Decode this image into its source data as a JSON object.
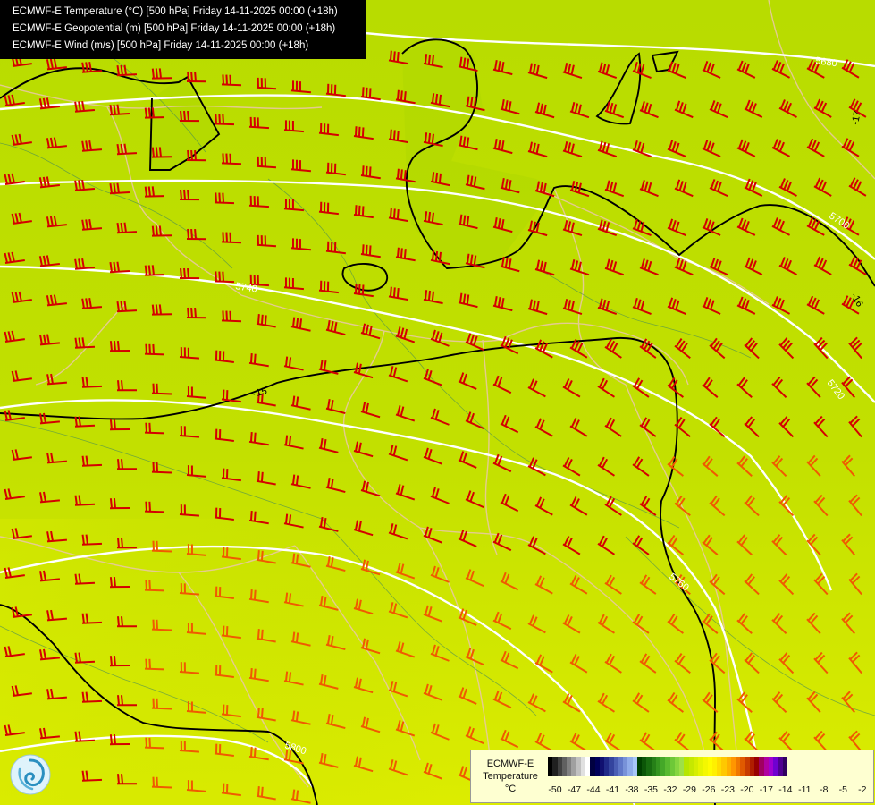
{
  "header": {
    "lines": [
      "ECMWF-E Temperature (°C) [500 hPa] Friday 14-11-2025 00:00 (+18h)",
      "ECMWF-E Geopotential (m) [500 hPa] Friday 14-11-2025 00:00 (+18h)",
      "ECMWF-E Wind (m/s) [500 hPa] Friday 14-11-2025 00:00 (+18h)"
    ]
  },
  "map": {
    "geopotential_labels": [
      "5680",
      "5700",
      "5720",
      "5740",
      "5760",
      "5800"
    ],
    "isotherm_labels": [
      "-15",
      "-16",
      "-17"
    ],
    "colors": {
      "background": "#c6e000",
      "geopotential_line": "#ffffff",
      "isotherm_line": "#000000",
      "wind_barb": "#d40000",
      "wind_barb_south": "#f05a00",
      "borders": "#e8c9a0",
      "rivers": "#2d7a6a"
    }
  },
  "legend": {
    "title_line1": "ECMWF-E",
    "title_line2": "Temperature",
    "unit": "°C",
    "ticks": [
      "-50",
      "-47",
      "-44",
      "-41",
      "-38",
      "-35",
      "-32",
      "-29",
      "-26",
      "-23",
      "-20",
      "-17",
      "-14",
      "-11",
      "-8",
      "-5",
      "-2"
    ],
    "colors": [
      "#000000",
      "#202020",
      "#404040",
      "#606060",
      "#808080",
      "#a0a0a0",
      "#c0c0c0",
      "#e0e0e0",
      "#ffffff",
      "#000040",
      "#00005a",
      "#101070",
      "#202a88",
      "#34449e",
      "#4a5eb4",
      "#6078c8",
      "#7892d8",
      "#90acea",
      "#a8c6f8",
      "#004000",
      "#0c5608",
      "#186c10",
      "#268018",
      "#349420",
      "#44a828",
      "#58ba30",
      "#6ec838",
      "#86d640",
      "#9ee048",
      "#b6e600",
      "#c6e800",
      "#d6ee00",
      "#e6f400",
      "#f4f800",
      "#fffc00",
      "#fff000",
      "#ffdc00",
      "#ffc800",
      "#ffb000",
      "#ff9600",
      "#f07800",
      "#e05a00",
      "#c83c00",
      "#b01e00",
      "#980000",
      "#a00060",
      "#b000a0",
      "#a000d0",
      "#7000d0",
      "#500090",
      "#300060"
    ]
  },
  "logo": {
    "icon": "ecmwf-swirl-logo"
  }
}
